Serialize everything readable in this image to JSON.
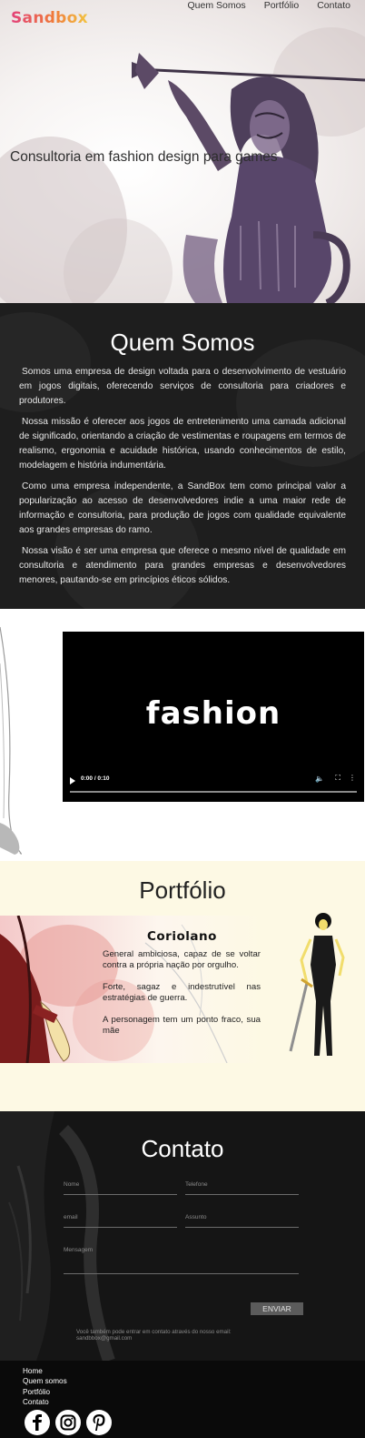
{
  "header": {
    "logo": "Sandbox",
    "nav": [
      "Quem Somos",
      "Portfólio",
      "Contato"
    ]
  },
  "hero": {
    "tagline": "Consultoria em fashion design para games"
  },
  "about": {
    "title": "Quem Somos",
    "paragraphs": [
      "Somos uma empresa de design voltada para o desenvolvimento de vestuário em jogos digitais, oferecendo serviços de consultoria para criadores e produtores.",
      "Nossa missão é oferecer aos jogos de entretenimento uma camada adicional de significado, orientando a criação de vestimentas e roupagens em termos de realismo, ergonomia e acuidade histórica, usando conhecimentos de estilo, modelagem e história indumentária.",
      "Como uma empresa independente, a SandBox tem como principal valor a popularização ao acesso de desenvolvedores indie a uma maior rede de informação e consultoria, para produção de jogos com qualidade equivalente aos grandes empresas do ramo.",
      "Nossa visão é ser uma empresa que oferece o mesmo nível de qualidade em consultoria e atendimento para grandes empresas e desenvolvedores menores, pautando-se em princípios éticos sólidos."
    ]
  },
  "video": {
    "title": "fashion",
    "time": "0:00 / 0:10",
    "progress": 0
  },
  "portfolio": {
    "title": "Portfólio",
    "card": {
      "name": "Coriolano",
      "paragraphs": [
        "General ambiciosa, capaz de se voltar contra a própria nação por orgulho.",
        "Forte, sagaz e indestrutível nas estratégias de guerra.",
        "A personagem tem um ponto fraco, sua mãe"
      ]
    }
  },
  "contact": {
    "title": "Contato",
    "fields": {
      "name": "Nome",
      "phone": "Telefone",
      "email": "email",
      "subject": "Assunto",
      "message": "Mensagem"
    },
    "send_label": "ENVIAR",
    "note": "Você também pode entrar em contato através do nosso email: sandbbox@gmail.com"
  },
  "footer": {
    "nav": [
      "Home",
      "Quem somos",
      "Portfólio",
      "Contato"
    ],
    "social": [
      "facebook-icon",
      "instagram-icon",
      "pinterest-icon"
    ]
  },
  "colors": {
    "about_bg": "#1e1e1e",
    "portfolio_bg": "#fdf9e4",
    "contact_bg": "#151515",
    "footer_bg": "#0a0a0a",
    "send_button": "#5b5b5b",
    "hero_accent": "#5c4a66"
  }
}
